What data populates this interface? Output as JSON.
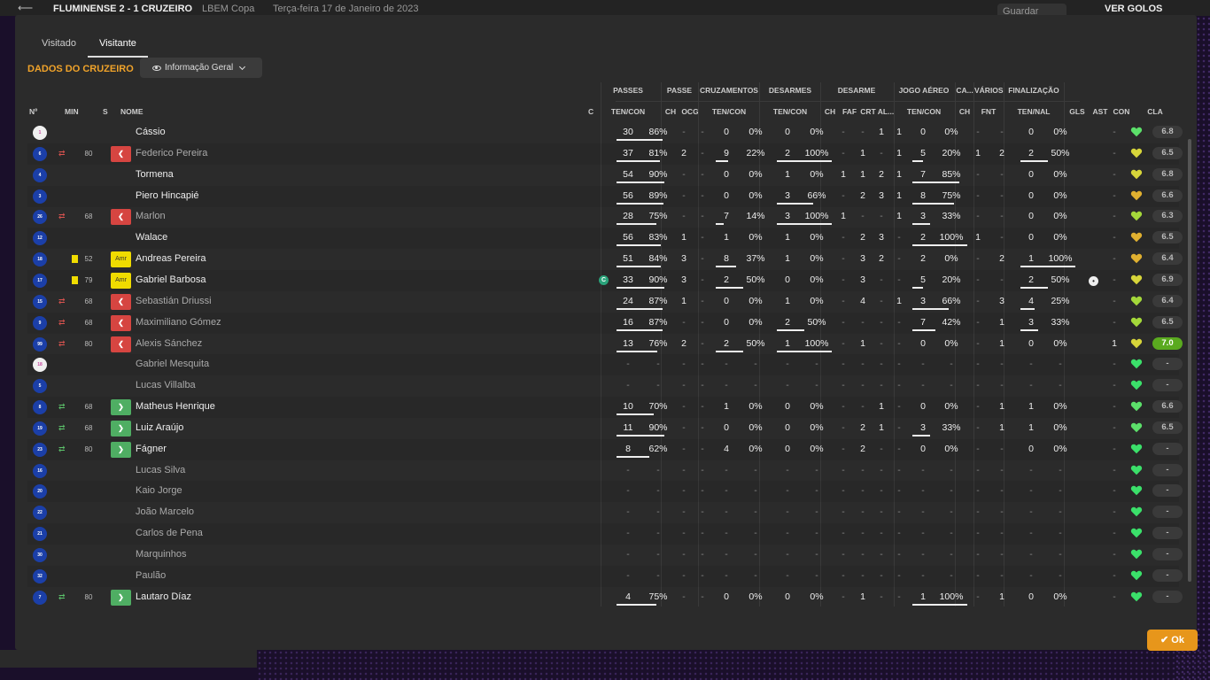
{
  "topbar": {
    "match": "FLUMINENSE  2 - 1  CRUZEIRO",
    "competition": "LBEM Copa",
    "date": "Terça-feira 17 de Janeiro de 2023",
    "save_label": "Guardar Jogo",
    "goals_label": "VER GOLOS"
  },
  "tabs": [
    {
      "label": "Visitado"
    },
    {
      "label": "Visitante"
    }
  ],
  "section_title": "DADOS DO CRUZEIRO",
  "view_dropdown": "Informação Geral",
  "group_headers": {
    "passes": "PASSES",
    "passe": "PASSE",
    "cruz": "CRUZAMENTOS",
    "desarmes": "DESARMES",
    "desarme": "DESARME",
    "aereo": "JOGO AÉREO",
    "ca": "CA...",
    "varios": "VÁRIOS",
    "final": "FINALIZAÇÃO"
  },
  "columns": {
    "no": "Nº",
    "min": "MIN",
    "s": "S",
    "nome": "NOME",
    "c": "C",
    "tencon1": "TEN/CON",
    "ch1": "CH",
    "ocg": "OCG",
    "tencon2": "TEN/CON",
    "tencon3": "TEN/CON",
    "ch2": "CH",
    "faf": "FAF",
    "crt": "CRT",
    "al": "AL...",
    "tencon4": "TEN/CON",
    "ch3": "CH",
    "fnt": "FNT",
    "tennal": "TEN/NAL",
    "gls": "GLS",
    "ast": "AST",
    "con": "CON",
    "cla": "CLA"
  },
  "players": [
    {
      "no": "1",
      "gk": true,
      "sub": "",
      "min": "",
      "status": "",
      "name": "Cássio",
      "dim": false,
      "pass": [
        "30",
        "86%"
      ],
      "passbar": 0.86,
      "ch": "-",
      "ocg": "-",
      "cruz": [
        "0",
        "0%"
      ],
      "cruzbar": 0,
      "des": [
        "0",
        "0%"
      ],
      "desbar": 0,
      "dch": "-",
      "faf": "-",
      "crt": "1",
      "al": "1",
      "aer": [
        "0",
        "0%"
      ],
      "aerbar": 0,
      "cach": "-",
      "fnt": "-",
      "fin": [
        "0",
        "0%"
      ],
      "finbar": 0,
      "gls": "",
      "ast": "-",
      "con": "#5ce06a",
      "cla": "6.8"
    },
    {
      "no": "6",
      "sub": "out",
      "min": "80",
      "status": "out",
      "name": "Federico Pereira",
      "dim": true,
      "pass": [
        "37",
        "81%"
      ],
      "passbar": 0.81,
      "ch": "2",
      "ocg": "-",
      "cruz": [
        "9",
        "22%"
      ],
      "cruzbar": 0.22,
      "des": [
        "2",
        "100%"
      ],
      "desbar": 1,
      "dch": "-",
      "faf": "1",
      "crt": "-",
      "al": "1",
      "aer": [
        "5",
        "20%"
      ],
      "aerbar": 0.2,
      "cach": "1",
      "fnt": "2",
      "fin": [
        "2",
        "50%"
      ],
      "finbar": 0.5,
      "gls": "",
      "ast": "-",
      "con": "#d7d53a",
      "cla": "6.5"
    },
    {
      "no": "4",
      "sub": "",
      "min": "",
      "status": "",
      "name": "Tormena",
      "dim": false,
      "pass": [
        "54",
        "90%"
      ],
      "passbar": 0.9,
      "ch": "-",
      "ocg": "-",
      "cruz": [
        "0",
        "0%"
      ],
      "cruzbar": 0,
      "des": [
        "1",
        "0%"
      ],
      "desbar": 0,
      "dch": "1",
      "faf": "1",
      "crt": "2",
      "al": "1",
      "aer": [
        "7",
        "85%"
      ],
      "aerbar": 0.85,
      "cach": "-",
      "fnt": "-",
      "fin": [
        "0",
        "0%"
      ],
      "finbar": 0,
      "gls": "",
      "ast": "-",
      "con": "#d7d53a",
      "cla": "6.8"
    },
    {
      "no": "3",
      "sub": "",
      "min": "",
      "status": "",
      "name": "Piero Hincapié",
      "dim": false,
      "pass": [
        "56",
        "89%"
      ],
      "passbar": 0.89,
      "ch": "-",
      "ocg": "-",
      "cruz": [
        "0",
        "0%"
      ],
      "cruzbar": 0,
      "des": [
        "3",
        "66%"
      ],
      "desbar": 0.66,
      "dch": "-",
      "faf": "2",
      "crt": "3",
      "al": "1",
      "aer": [
        "8",
        "75%"
      ],
      "aerbar": 0.75,
      "cach": "-",
      "fnt": "-",
      "fin": [
        "0",
        "0%"
      ],
      "finbar": 0,
      "gls": "",
      "ast": "-",
      "con": "#e0b030",
      "cla": "6.6"
    },
    {
      "no": "26",
      "sub": "out",
      "min": "68",
      "status": "out",
      "name": "Marlon",
      "dim": true,
      "pass": [
        "28",
        "75%"
      ],
      "passbar": 0.75,
      "ch": "-",
      "ocg": "-",
      "cruz": [
        "7",
        "14%"
      ],
      "cruzbar": 0.14,
      "des": [
        "3",
        "100%"
      ],
      "desbar": 1,
      "dch": "1",
      "faf": "-",
      "crt": "-",
      "al": "1",
      "aer": [
        "3",
        "33%"
      ],
      "aerbar": 0.33,
      "cach": "-",
      "fnt": "-",
      "fin": [
        "0",
        "0%"
      ],
      "finbar": 0,
      "gls": "",
      "ast": "-",
      "con": "#a4d83a",
      "cla": "6.3"
    },
    {
      "no": "12",
      "sub": "",
      "min": "",
      "status": "",
      "name": "Walace",
      "dim": false,
      "pass": [
        "56",
        "83%"
      ],
      "passbar": 0.83,
      "ch": "1",
      "ocg": "-",
      "cruz": [
        "1",
        "0%"
      ],
      "cruzbar": 0,
      "des": [
        "1",
        "0%"
      ],
      "desbar": 0,
      "dch": "-",
      "faf": "2",
      "crt": "3",
      "al": "-",
      "aer": [
        "2",
        "100%"
      ],
      "aerbar": 1,
      "cach": "1",
      "fnt": "-",
      "fin": [
        "0",
        "0%"
      ],
      "finbar": 0,
      "gls": "",
      "ast": "-",
      "con": "#e0b030",
      "cla": "6.5"
    },
    {
      "no": "18",
      "card": true,
      "sub": "",
      "min": "52",
      "status": "amr",
      "name": "Andreas Pereira",
      "dim": false,
      "pass": [
        "51",
        "84%"
      ],
      "passbar": 0.84,
      "ch": "3",
      "ocg": "-",
      "cruz": [
        "8",
        "37%"
      ],
      "cruzbar": 0.37,
      "des": [
        "1",
        "0%"
      ],
      "desbar": 0,
      "dch": "-",
      "faf": "3",
      "crt": "2",
      "al": "-",
      "aer": [
        "2",
        "0%"
      ],
      "aerbar": 0,
      "cach": "-",
      "fnt": "2",
      "fin": [
        "1",
        "100%"
      ],
      "finbar": 1,
      "gls": "",
      "ast": "-",
      "con": "#e0b030",
      "cla": "6.4"
    },
    {
      "no": "17",
      "card": true,
      "sub": "",
      "min": "79",
      "status": "amr",
      "name": "Gabriel Barbosa",
      "dim": false,
      "captain": "C",
      "pass": [
        "33",
        "90%"
      ],
      "passbar": 0.9,
      "ch": "3",
      "ocg": "-",
      "cruz": [
        "2",
        "50%"
      ],
      "cruzbar": 0.5,
      "des": [
        "0",
        "0%"
      ],
      "desbar": 0,
      "dch": "-",
      "faf": "3",
      "crt": "-",
      "al": "-",
      "aer": [
        "5",
        "20%"
      ],
      "aerbar": 0.2,
      "cach": "-",
      "fnt": "-",
      "fin": [
        "2",
        "50%"
      ],
      "finbar": 0.5,
      "gls": "⚽",
      "ast": "-",
      "con": "#d7d53a",
      "cla": "6.9"
    },
    {
      "no": "15",
      "sub": "out",
      "min": "68",
      "status": "out",
      "name": "Sebastián Driussi",
      "dim": true,
      "pass": [
        "24",
        "87%"
      ],
      "passbar": 0.87,
      "ch": "1",
      "ocg": "-",
      "cruz": [
        "0",
        "0%"
      ],
      "cruzbar": 0,
      "des": [
        "1",
        "0%"
      ],
      "desbar": 0,
      "dch": "-",
      "faf": "4",
      "crt": "-",
      "al": "1",
      "aer": [
        "3",
        "66%"
      ],
      "aerbar": 0.66,
      "cach": "-",
      "fnt": "3",
      "fin": [
        "4",
        "25%"
      ],
      "finbar": 0.25,
      "gls": "",
      "ast": "-",
      "con": "#a4d83a",
      "cla": "6.4"
    },
    {
      "no": "9",
      "sub": "out",
      "min": "68",
      "status": "out",
      "name": "Maximiliano Gómez",
      "dim": true,
      "pass": [
        "16",
        "87%"
      ],
      "passbar": 0.87,
      "ch": "-",
      "ocg": "-",
      "cruz": [
        "0",
        "0%"
      ],
      "cruzbar": 0,
      "des": [
        "2",
        "50%"
      ],
      "desbar": 0.5,
      "dch": "-",
      "faf": "-",
      "crt": "-",
      "al": "-",
      "aer": [
        "7",
        "42%"
      ],
      "aerbar": 0.42,
      "cach": "-",
      "fnt": "1",
      "fin": [
        "3",
        "33%"
      ],
      "finbar": 0.33,
      "gls": "",
      "ast": "-",
      "con": "#a4d83a",
      "cla": "6.5"
    },
    {
      "no": "99",
      "sub": "out",
      "min": "80",
      "status": "out",
      "name": "Alexis Sánchez",
      "dim": true,
      "pass": [
        "13",
        "76%"
      ],
      "passbar": 0.76,
      "ch": "2",
      "ocg": "-",
      "cruz": [
        "2",
        "50%"
      ],
      "cruzbar": 0.5,
      "des": [
        "1",
        "100%"
      ],
      "desbar": 1,
      "dch": "-",
      "faf": "1",
      "crt": "-",
      "al": "-",
      "aer": [
        "0",
        "0%"
      ],
      "aerbar": 0,
      "cach": "-",
      "fnt": "1",
      "fin": [
        "0",
        "0%"
      ],
      "finbar": 0,
      "gls": "",
      "ast": "1",
      "con": "#d7d53a",
      "cla": "7.0",
      "best": true
    },
    {
      "no": "18",
      "gk": true,
      "sub": "",
      "min": "",
      "status": "",
      "name": "Gabriel Mesquita",
      "dim": true,
      "pass": [
        "-",
        "-"
      ],
      "passbar": 0,
      "ch": "-",
      "ocg": "-",
      "cruz": [
        "-",
        "-"
      ],
      "cruzbar": 0,
      "des": [
        "-",
        "-"
      ],
      "desbar": 0,
      "dch": "-",
      "faf": "-",
      "crt": "-",
      "al": "-",
      "aer": [
        "-",
        "-"
      ],
      "aerbar": 0,
      "cach": "-",
      "fnt": "-",
      "fin": [
        "-",
        "-"
      ],
      "finbar": 0,
      "gls": "",
      "ast": "-",
      "con": "#3be06a",
      "cla": "-"
    },
    {
      "no": "5",
      "sub": "",
      "min": "",
      "status": "",
      "name": "Lucas Villalba",
      "dim": true,
      "pass": [
        "-",
        "-"
      ],
      "passbar": 0,
      "ch": "-",
      "ocg": "-",
      "cruz": [
        "-",
        "-"
      ],
      "cruzbar": 0,
      "des": [
        "-",
        "-"
      ],
      "desbar": 0,
      "dch": "-",
      "faf": "-",
      "crt": "-",
      "al": "-",
      "aer": [
        "-",
        "-"
      ],
      "aerbar": 0,
      "cach": "-",
      "fnt": "-",
      "fin": [
        "-",
        "-"
      ],
      "finbar": 0,
      "gls": "",
      "ast": "-",
      "con": "#3be06a",
      "cla": "-"
    },
    {
      "no": "8",
      "sub": "in",
      "min": "68",
      "status": "in",
      "name": "Matheus Henrique",
      "dim": false,
      "pass": [
        "10",
        "70%"
      ],
      "passbar": 0.7,
      "ch": "-",
      "ocg": "-",
      "cruz": [
        "1",
        "0%"
      ],
      "cruzbar": 0,
      "des": [
        "0",
        "0%"
      ],
      "desbar": 0,
      "dch": "-",
      "faf": "-",
      "crt": "1",
      "al": "-",
      "aer": [
        "0",
        "0%"
      ],
      "aerbar": 0,
      "cach": "-",
      "fnt": "1",
      "fin": [
        "1",
        "0%"
      ],
      "finbar": 0,
      "gls": "",
      "ast": "-",
      "con": "#5ce06a",
      "cla": "6.6"
    },
    {
      "no": "19",
      "sub": "in",
      "min": "68",
      "status": "in",
      "name": "Luiz Araújo",
      "dim": false,
      "pass": [
        "11",
        "90%"
      ],
      "passbar": 0.9,
      "ch": "-",
      "ocg": "-",
      "cruz": [
        "0",
        "0%"
      ],
      "cruzbar": 0,
      "des": [
        "0",
        "0%"
      ],
      "desbar": 0,
      "dch": "-",
      "faf": "2",
      "crt": "1",
      "al": "-",
      "aer": [
        "3",
        "33%"
      ],
      "aerbar": 0.33,
      "cach": "-",
      "fnt": "1",
      "fin": [
        "1",
        "0%"
      ],
      "finbar": 0,
      "gls": "",
      "ast": "-",
      "con": "#5ce06a",
      "cla": "6.5"
    },
    {
      "no": "23",
      "sub": "in",
      "min": "80",
      "status": "in",
      "name": "Fágner",
      "dim": false,
      "pass": [
        "8",
        "62%"
      ],
      "passbar": 0.62,
      "ch": "-",
      "ocg": "-",
      "cruz": [
        "4",
        "0%"
      ],
      "cruzbar": 0,
      "des": [
        "0",
        "0%"
      ],
      "desbar": 0,
      "dch": "-",
      "faf": "2",
      "crt": "-",
      "al": "-",
      "aer": [
        "0",
        "0%"
      ],
      "aerbar": 0,
      "cach": "-",
      "fnt": "-",
      "fin": [
        "0",
        "0%"
      ],
      "finbar": 0,
      "gls": "",
      "ast": "-",
      "con": "#3be06a",
      "cla": "-"
    },
    {
      "no": "16",
      "sub": "",
      "min": "",
      "status": "",
      "name": "Lucas Silva",
      "dim": true,
      "pass": [
        "-",
        "-"
      ],
      "passbar": 0,
      "ch": "-",
      "ocg": "-",
      "cruz": [
        "-",
        "-"
      ],
      "cruzbar": 0,
      "des": [
        "-",
        "-"
      ],
      "desbar": 0,
      "dch": "-",
      "faf": "-",
      "crt": "-",
      "al": "-",
      "aer": [
        "-",
        "-"
      ],
      "aerbar": 0,
      "cach": "-",
      "fnt": "-",
      "fin": [
        "-",
        "-"
      ],
      "finbar": 0,
      "gls": "",
      "ast": "-",
      "con": "#3be06a",
      "cla": "-"
    },
    {
      "no": "20",
      "sub": "",
      "min": "",
      "status": "",
      "name": "Kaio Jorge",
      "dim": true,
      "pass": [
        "-",
        "-"
      ],
      "passbar": 0,
      "ch": "-",
      "ocg": "-",
      "cruz": [
        "-",
        "-"
      ],
      "cruzbar": 0,
      "des": [
        "-",
        "-"
      ],
      "desbar": 0,
      "dch": "-",
      "faf": "-",
      "crt": "-",
      "al": "-",
      "aer": [
        "-",
        "-"
      ],
      "aerbar": 0,
      "cach": "-",
      "fnt": "-",
      "fin": [
        "-",
        "-"
      ],
      "finbar": 0,
      "gls": "",
      "ast": "-",
      "con": "#3be06a",
      "cla": "-"
    },
    {
      "no": "22",
      "sub": "",
      "min": "",
      "status": "",
      "name": "João Marcelo",
      "dim": true,
      "pass": [
        "-",
        "-"
      ],
      "passbar": 0,
      "ch": "-",
      "ocg": "-",
      "cruz": [
        "-",
        "-"
      ],
      "cruzbar": 0,
      "des": [
        "-",
        "-"
      ],
      "desbar": 0,
      "dch": "-",
      "faf": "-",
      "crt": "-",
      "al": "-",
      "aer": [
        "-",
        "-"
      ],
      "aerbar": 0,
      "cach": "-",
      "fnt": "-",
      "fin": [
        "-",
        "-"
      ],
      "finbar": 0,
      "gls": "",
      "ast": "-",
      "con": "#3be06a",
      "cla": "-"
    },
    {
      "no": "21",
      "sub": "",
      "min": "",
      "status": "",
      "name": "Carlos de Pena",
      "dim": true,
      "pass": [
        "-",
        "-"
      ],
      "passbar": 0,
      "ch": "-",
      "ocg": "-",
      "cruz": [
        "-",
        "-"
      ],
      "cruzbar": 0,
      "des": [
        "-",
        "-"
      ],
      "desbar": 0,
      "dch": "-",
      "faf": "-",
      "crt": "-",
      "al": "-",
      "aer": [
        "-",
        "-"
      ],
      "aerbar": 0,
      "cach": "-",
      "fnt": "-",
      "fin": [
        "-",
        "-"
      ],
      "finbar": 0,
      "gls": "",
      "ast": "-",
      "con": "#3be06a",
      "cla": "-"
    },
    {
      "no": "30",
      "sub": "",
      "min": "",
      "status": "",
      "name": "Marquinhos",
      "dim": true,
      "pass": [
        "-",
        "-"
      ],
      "passbar": 0,
      "ch": "-",
      "ocg": "-",
      "cruz": [
        "-",
        "-"
      ],
      "cruzbar": 0,
      "des": [
        "-",
        "-"
      ],
      "desbar": 0,
      "dch": "-",
      "faf": "-",
      "crt": "-",
      "al": "-",
      "aer": [
        "-",
        "-"
      ],
      "aerbar": 0,
      "cach": "-",
      "fnt": "-",
      "fin": [
        "-",
        "-"
      ],
      "finbar": 0,
      "gls": "",
      "ast": "-",
      "con": "#3be06a",
      "cla": "-"
    },
    {
      "no": "32",
      "sub": "",
      "min": "",
      "status": "",
      "name": "Paulão",
      "dim": true,
      "pass": [
        "-",
        "-"
      ],
      "passbar": 0,
      "ch": "-",
      "ocg": "-",
      "cruz": [
        "-",
        "-"
      ],
      "cruzbar": 0,
      "des": [
        "-",
        "-"
      ],
      "desbar": 0,
      "dch": "-",
      "faf": "-",
      "crt": "-",
      "al": "-",
      "aer": [
        "-",
        "-"
      ],
      "aerbar": 0,
      "cach": "-",
      "fnt": "-",
      "fin": [
        "-",
        "-"
      ],
      "finbar": 0,
      "gls": "",
      "ast": "-",
      "con": "#3be06a",
      "cla": "-"
    },
    {
      "no": "7",
      "sub": "in",
      "min": "80",
      "status": "in",
      "name": "Lautaro Díaz",
      "dim": false,
      "pass": [
        "4",
        "75%"
      ],
      "passbar": 0.75,
      "ch": "-",
      "ocg": "-",
      "cruz": [
        "0",
        "0%"
      ],
      "cruzbar": 0,
      "des": [
        "0",
        "0%"
      ],
      "desbar": 0,
      "dch": "-",
      "faf": "1",
      "crt": "-",
      "al": "-",
      "aer": [
        "1",
        "100%"
      ],
      "aerbar": 1,
      "cach": "-",
      "fnt": "1",
      "fin": [
        "0",
        "0%"
      ],
      "finbar": 0,
      "gls": "",
      "ast": "-",
      "con": "#3be06a",
      "cla": "-"
    }
  ],
  "status_labels": {
    "amr": "Amr"
  },
  "ok_label": "Ok"
}
